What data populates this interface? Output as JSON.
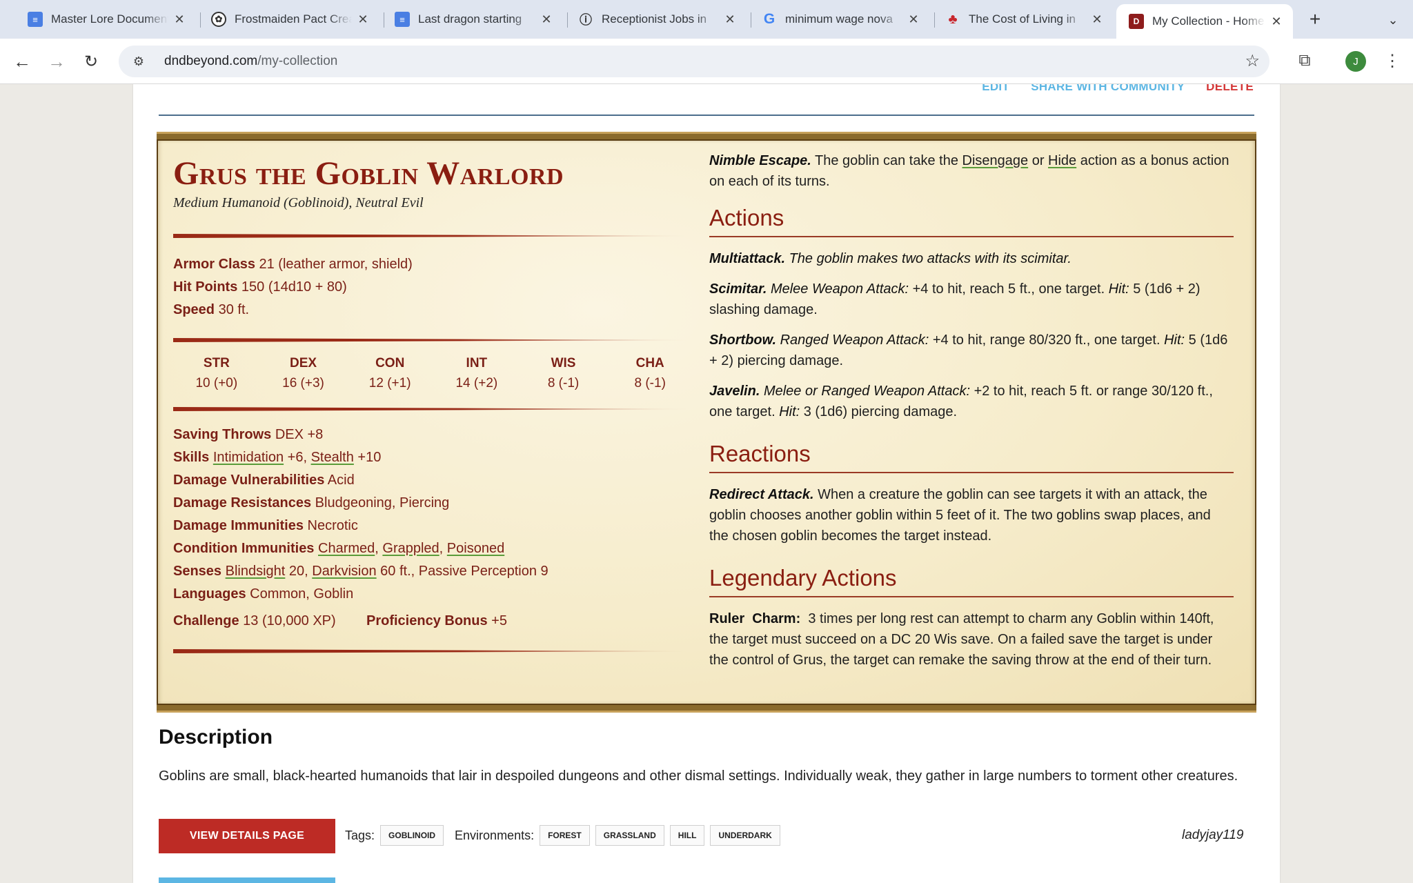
{
  "tabs": [
    {
      "title": "Master Lore Document",
      "favicon": "docs-icon"
    },
    {
      "title": "Frostmaiden Pact Creator",
      "favicon": "chatgpt-icon"
    },
    {
      "title": "Last dragon starting",
      "favicon": "docs-icon"
    },
    {
      "title": "Receptionist Jobs in",
      "favicon": "info-icon"
    },
    {
      "title": "minimum wage nova",
      "favicon": "google-icon"
    },
    {
      "title": "The Cost of Living in",
      "favicon": "leaf-icon"
    },
    {
      "title": "My Collection - Home",
      "favicon": "dndbeyond-icon",
      "active": true
    }
  ],
  "url": {
    "domain": "dndbeyond.com",
    "path": "/my-collection"
  },
  "profile_initial": "J",
  "page_actions": {
    "edit": "EDIT",
    "share": "SHARE WITH COMMUNITY",
    "delete": "DELETE"
  },
  "monster": {
    "name": "Grus the Goblin Warlord",
    "meta": "Medium Humanoid (Goblinoid), Neutral Evil",
    "armor_class": {
      "label": "Armor Class",
      "value": "21 (leather armor, shield)"
    },
    "hit_points": {
      "label": "Hit Points",
      "value": "150 (14d10 + 80)"
    },
    "speed": {
      "label": "Speed",
      "value": "30 ft."
    },
    "abilities": [
      {
        "name": "STR",
        "score": "10",
        "mod": "(+0)"
      },
      {
        "name": "DEX",
        "score": "16",
        "mod": "(+3)"
      },
      {
        "name": "CON",
        "score": "12",
        "mod": "(+1)"
      },
      {
        "name": "INT",
        "score": "14",
        "mod": "(+2)"
      },
      {
        "name": "WIS",
        "score": "8",
        "mod": "(-1)"
      },
      {
        "name": "CHA",
        "score": "8",
        "mod": "(-1)"
      }
    ],
    "saving_throws": {
      "label": "Saving Throws",
      "value": "DEX +8"
    },
    "skills": {
      "label": "Skills",
      "items": [
        {
          "name": "Intimidation",
          "bonus": " +6"
        },
        {
          "name": "Stealth",
          "bonus": " +10"
        }
      ],
      "sep": ", "
    },
    "damage_vulnerabilities": {
      "label": "Damage Vulnerabilities",
      "value": "Acid"
    },
    "damage_resistances": {
      "label": "Damage Resistances",
      "value": "Bludgeoning, Piercing"
    },
    "damage_immunities": {
      "label": "Damage Immunities",
      "value": "Necrotic"
    },
    "condition_immunities": {
      "label": "Condition Immunities",
      "items": [
        "Charmed",
        "Grappled",
        "Poisoned"
      ],
      "sep": ", "
    },
    "senses": {
      "label": "Senses",
      "blindsight": "Blindsight",
      "blindsight_val": " 20, ",
      "darkvision": "Darkvision",
      "rest": " 60 ft., Passive Perception 9"
    },
    "languages": {
      "label": "Languages",
      "value": "Common, Goblin"
    },
    "challenge": {
      "label": "Challenge",
      "value": "13 (10,000 XP)"
    },
    "proficiency": {
      "label": "Proficiency Bonus",
      "value": "+5"
    },
    "nimble": {
      "name": "Nimble Escape.",
      "pre": " The goblin can take the ",
      "link1": "Disengage",
      "mid": " or ",
      "link2": "Hide",
      "post": " action as a bonus action on each of its turns."
    },
    "actions_title": "Actions",
    "multiattack": {
      "name": "Multiattack.",
      "text": "The goblin makes two attacks with its scimitar."
    },
    "scimitar": {
      "name": "Scimitar.",
      "type": "Melee Weapon Attack:",
      "text": " +4 to hit, reach 5 ft., one target. ",
      "hit": "Hit:",
      "dmg": " 5 (1d6 + 2) slashing damage."
    },
    "shortbow": {
      "name": "Shortbow.",
      "type": "Ranged Weapon Attack:",
      "text": " +4 to hit, range 80/320 ft., one target. ",
      "hit": "Hit:",
      "dmg": " 5 (1d6 + 2) piercing damage."
    },
    "javelin": {
      "name": "Javelin.",
      "type": "Melee or Ranged Weapon Attack:",
      "text": " +2 to hit, reach 5 ft. or range 30/120 ft., one target. ",
      "hit": "Hit:",
      "dmg": " 3 (1d6) piercing damage."
    },
    "reactions_title": "Reactions",
    "redirect": {
      "name": "Redirect Attack.",
      "text": " When a creature the goblin can see targets it with an attack, the goblin chooses another goblin within 5 feet of it. The two goblins swap places, and the chosen goblin becomes the target instead."
    },
    "legendary_title": "Legendary Actions",
    "ruler": {
      "name": "Ruler  Charm:",
      "text": "  3 times per long rest can attempt to charm any Goblin within 140ft, the target must succeed on a DC 20 Wis save. On a failed save the target is under the control of Grus, the target can remake the saving throw at the end of their turn."
    }
  },
  "description": {
    "heading": "Description",
    "text": "Goblins are small, black-hearted humanoids that lair in despoiled dungeons and other dismal settings. Individually weak, they gather in large numbers to torment other creatures."
  },
  "details_button": "VIEW DETAILS PAGE",
  "tags_label": "Tags:",
  "tags": [
    "GOBLINOID"
  ],
  "environments_label": "Environments:",
  "environments": [
    "FOREST",
    "GRASSLAND",
    "HILL",
    "UNDERDARK"
  ],
  "author": "ladyjay119",
  "colors": {
    "accent_red": "#bd2b25",
    "statblock_red": "#7a1f16",
    "link_blue": "#5cb6e3"
  }
}
